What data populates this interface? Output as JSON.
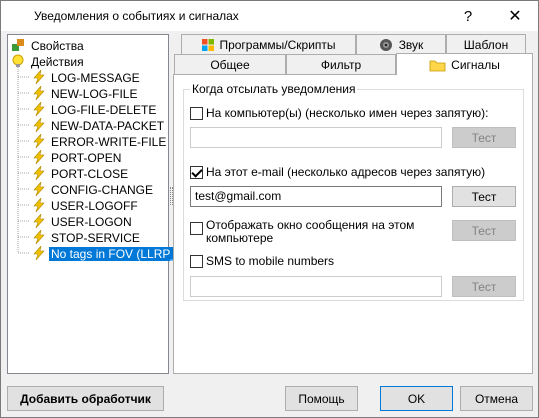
{
  "window": {
    "title": "Уведомления о событиях и сигналах",
    "help_glyph": "?",
    "close_glyph": "✕"
  },
  "tree": {
    "root_properties": "Свойства",
    "root_actions": "Действия",
    "actions": [
      "LOG-MESSAGE",
      "NEW-LOG-FILE",
      "LOG-FILE-DELETE",
      "NEW-DATA-PACKET",
      "ERROR-WRITE-FILE",
      "PORT-OPEN",
      "PORT-CLOSE",
      "CONFIG-CHANGE",
      "USER-LOGOFF",
      "USER-LOGON",
      "STOP-SERVICE",
      "No tags in FOV (LLRP_"
    ],
    "selected_index": 11
  },
  "tabs": {
    "programs": "Программы/Скрипты",
    "sound": "Звук",
    "template": "Шаблон",
    "general": "Общее",
    "filter": "Фильтр",
    "signals": "Сигналы",
    "active": "signals"
  },
  "signals": {
    "group_title": "Когда отсылать уведомления",
    "computer_label": "На компьютер(ы) (несколько имен через запятую):",
    "computer_checked": false,
    "computer_value": "",
    "email_label": "На этот e-mail (несколько адресов через запятую)",
    "email_checked": true,
    "email_value": "test@gmail.com",
    "popup_label_line1": "Отображать окно сообщения на этом",
    "popup_label_line2": "компьютере",
    "popup_checked": false,
    "sms_label": "SMS to mobile numbers",
    "sms_checked": false,
    "sms_value": "",
    "test_label": "Тест"
  },
  "footer": {
    "add_handler": "Добавить обработчик",
    "help": "Помощь",
    "ok": "OK",
    "cancel": "Отмена"
  },
  "colors": {
    "selection": "#0078d7",
    "bolt": "#f2c200"
  }
}
